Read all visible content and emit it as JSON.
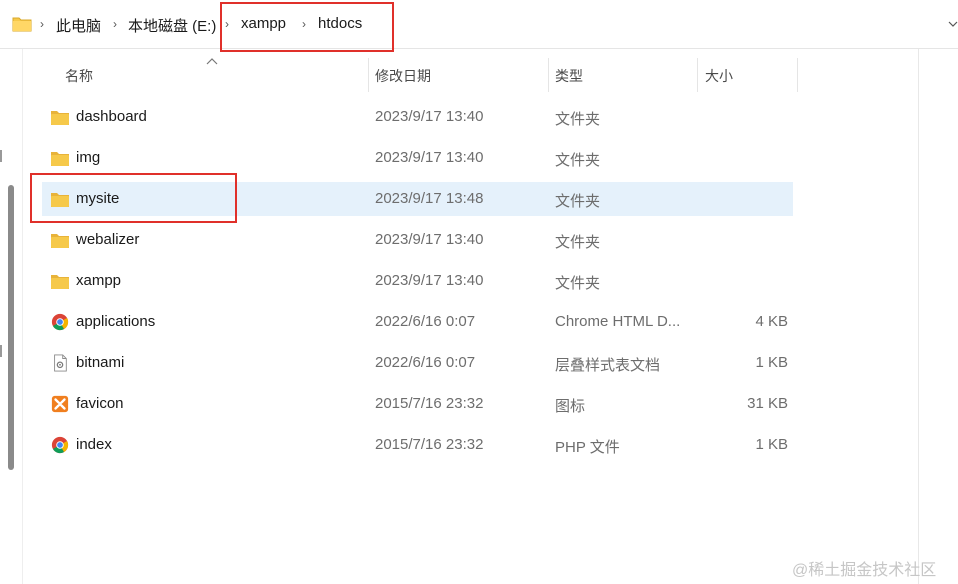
{
  "breadcrumb": {
    "items": [
      "此电脑",
      "本地磁盘 (E:)",
      "xampp",
      "htdocs"
    ]
  },
  "columns": {
    "name": "名称",
    "date": "修改日期",
    "type": "类型",
    "size": "大小"
  },
  "files": [
    {
      "name": "dashboard",
      "date": "2023/9/17 13:40",
      "type": "文件夹",
      "size": "",
      "icon": "folder-icon"
    },
    {
      "name": "img",
      "date": "2023/9/17 13:40",
      "type": "文件夹",
      "size": "",
      "icon": "folder-icon"
    },
    {
      "name": "mysite",
      "date": "2023/9/17 13:48",
      "type": "文件夹",
      "size": "",
      "icon": "folder-icon",
      "selected": true
    },
    {
      "name": "webalizer",
      "date": "2023/9/17 13:40",
      "type": "文件夹",
      "size": "",
      "icon": "folder-icon"
    },
    {
      "name": "xampp",
      "date": "2023/9/17 13:40",
      "type": "文件夹",
      "size": "",
      "icon": "folder-icon"
    },
    {
      "name": "applications",
      "date": "2022/6/16 0:07",
      "type": "Chrome HTML D...",
      "size": "4 KB",
      "icon": "chrome-icon"
    },
    {
      "name": "bitnami",
      "date": "2022/6/16 0:07",
      "type": "层叠样式表文档",
      "size": "1 KB",
      "icon": "css-file-icon"
    },
    {
      "name": "favicon",
      "date": "2015/7/16 23:32",
      "type": "图标",
      "size": "31 KB",
      "icon": "xampp-icon"
    },
    {
      "name": "index",
      "date": "2015/7/16 23:32",
      "type": "PHP 文件",
      "size": "1 KB",
      "icon": "chrome-icon"
    }
  ],
  "watermark": "@稀土掘金技术社区",
  "colors": {
    "selection": "#e5f1fb",
    "highlight_box": "#e0302a",
    "folder": "#f6c94a"
  }
}
